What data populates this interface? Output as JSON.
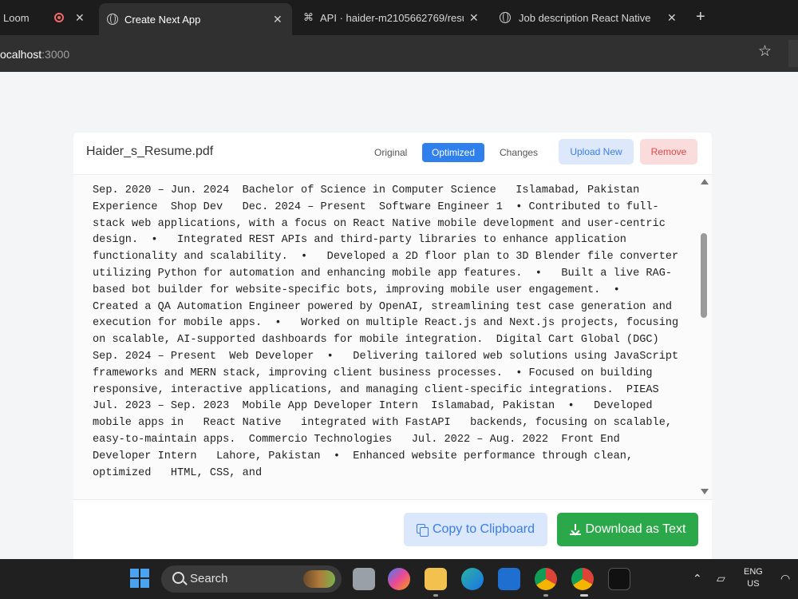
{
  "browser": {
    "tabs": [
      {
        "label": "Loom",
        "icon": "loom-icon"
      },
      {
        "label": "",
        "icon": "recording-icon"
      },
      {
        "label": "Create Next App",
        "icon": "globe-icon",
        "active": true
      },
      {
        "label": "API · haider-m2105662769/resu",
        "icon": "api-icon"
      },
      {
        "label": "Job description React Native",
        "icon": "chatgpt-icon"
      }
    ],
    "new_tab": "+",
    "url_host": "ocalhost",
    "url_port": ":3000",
    "bookmark_icon": "☆"
  },
  "card": {
    "filename": "Haider_s_Resume.pdf",
    "view_tabs": [
      "Original",
      "Optimized",
      "Changes"
    ],
    "active_view": "Optimized",
    "upload_label": "Upload New",
    "remove_label": "Remove",
    "resume_text": "Sep. 2020 – Jun. 2024  Bachelor of Science in Computer Science   Islamabad, Pakistan  Experience  Shop Dev   Dec. 2024 – Present  Software Engineer 1  • Contributed to full-stack web applications, with a focus on React Native mobile development and user-centric design.  •   Integrated REST APIs and third-party libraries to enhance application functionality and scalability.  •   Developed a 2D floor plan to 3D Blender file converter utilizing Python for automation and enhancing mobile app features.  •   Built a live RAG-based bot builder for website-specific bots, improving mobile user engagement.  •   Created a QA Automation Engineer powered by OpenAI, streamlining test case generation and execution for mobile apps.  •   Worked on multiple React.js and Next.js projects, focusing on scalable, AI-supported dashboards for mobile integration.  Digital Cart Global (DGC)   Sep. 2024 – Present  Web Developer  •   Delivering tailored web solutions using JavaScript frameworks and MERN stack, improving client business processes.  • Focused on building responsive, interactive applications, and managing client-specific integrations.  PIEAS   Jul. 2023 – Sep. 2023  Mobile App Developer Intern  Islamabad, Pakistan  •   Developed mobile apps in   React Native   integrated with FastAPI   backends, focusing on scalable, easy-to-maintain apps.  Commercio Technologies   Jul. 2022 – Aug. 2022  Front End Developer Intern   Lahore, Pakistan  •  Enhanced website performance through clean, optimized   HTML, CSS, and",
    "copy_label": "Copy to Clipboard",
    "download_label": "Download as Text"
  },
  "taskbar": {
    "search_label": "Search",
    "lang_line1": "ENG",
    "lang_line2": "US",
    "apps": [
      "file-explorer-icon",
      "copilot-icon",
      "folder-icon",
      "edge-icon",
      "outlook-icon",
      "chrome-icon",
      "chrome-profile-icon",
      "terminal-icon"
    ]
  },
  "colors": {
    "primary": "#2f80ed",
    "success": "#2aa84a",
    "danger": "#e04848"
  }
}
